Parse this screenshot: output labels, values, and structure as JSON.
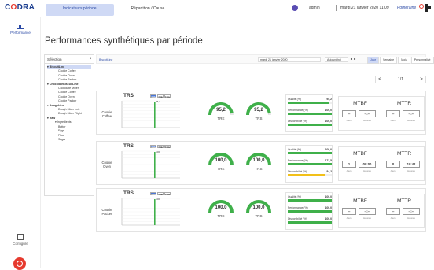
{
  "app": {
    "logo_prefix": "C",
    "logo_o": "O",
    "logo_suffix": "DRA"
  },
  "tabs": [
    "Indicateurs période",
    "Répartition / Cause"
  ],
  "header": {
    "user": "admin",
    "datetime": "mardi 21 janvier 2020 11:09",
    "brand": "Pomoraine"
  },
  "leftnav": {
    "performance": "Performance",
    "configure": "Configure"
  },
  "page": {
    "title": "Performances synthétiques par période"
  },
  "selector": {
    "label": "Sélection",
    "tree": [
      {
        "label": "BiscuitLine",
        "level": "group",
        "hl": true
      },
      {
        "label": "Cookie Coffee",
        "level": "l3"
      },
      {
        "label": "Cookie Oven",
        "level": "l3"
      },
      {
        "label": "Cookie Packer",
        "level": "l3"
      },
      {
        "label": "ChocolateBiscuitLine",
        "level": "group"
      },
      {
        "label": "Chocolate Mixer",
        "level": "l3"
      },
      {
        "label": "Cookie Coffee",
        "level": "l3"
      },
      {
        "label": "Cookie Oven",
        "level": "l3"
      },
      {
        "label": "Cookie Packer",
        "level": "l3"
      },
      {
        "label": "DoughLine",
        "level": "group"
      },
      {
        "label": "Dough Mixer Left",
        "level": "l3"
      },
      {
        "label": "Dough Mixer Right",
        "level": "l3"
      },
      {
        "label": "Raw",
        "level": "group"
      },
      {
        "label": "Ingredients",
        "level": "l2"
      },
      {
        "label": "Butter",
        "level": "l3"
      },
      {
        "label": "Eggs",
        "level": "l3"
      },
      {
        "label": "Flour",
        "level": "l3"
      },
      {
        "label": "Sugar",
        "level": "l3"
      }
    ]
  },
  "filter": {
    "crumb": "BiscuitLine",
    "date": "mardi 21 janvier 2020",
    "period": "Aujourd'hui",
    "arrows": "◄ ►",
    "buttons": [
      "Jour",
      "Semaine",
      "Mois",
      "Personnalisé"
    ],
    "active_button": "Jour"
  },
  "pager": {
    "prev": "<",
    "text": "1/1",
    "next": ">"
  },
  "labels": {
    "chart_title": "TRS",
    "toggles": [
      "TRS",
      "TRE",
      "TRG"
    ],
    "gauge_tre": "TRE",
    "gauge_trs": "TRS",
    "qualite": "Qualité (%)",
    "performance": "Performance (%)",
    "disponibilite": "Disponibilité (%)",
    "mtbf": "MTBF",
    "mttr": "MTTR",
    "jours": "Jours",
    "heures": "Heures"
  },
  "cards": [
    {
      "name": "Cookie Coffee",
      "annot": "95,2",
      "gauge_tre": "95,2",
      "gauge_trs": "95,2",
      "tre_frac": 0.952,
      "trs_frac": 0.952,
      "qualite": "95,2",
      "performance": "100,0",
      "disponibilite": "100,0",
      "q_frac": 0.952,
      "p_frac": 1.0,
      "d_frac": 1.0,
      "mtbf_j": "--",
      "mtbf_h": "--:--",
      "mttr_j": "--",
      "mttr_h": "--:--"
    },
    {
      "name": "Cookie Oven",
      "annot": "100",
      "gauge_tre": "100,0",
      "gauge_trs": "100,0",
      "tre_frac": 1.0,
      "trs_frac": 1.0,
      "qualite": "100,0",
      "performance": "172,5",
      "disponibilite": "84,2",
      "q_frac": 1.0,
      "p_frac": 1.0,
      "d_frac": 0.842,
      "mtbf_j": "1",
      "mtbf_h": "00:00",
      "mttr_j": "0",
      "mttr_h": "10:42"
    },
    {
      "name": "Cookie Packer",
      "annot": "100",
      "gauge_tre": "100,0",
      "gauge_trs": "100,0",
      "tre_frac": 1.0,
      "trs_frac": 1.0,
      "qualite": "100,0",
      "performance": "100,0",
      "disponibilite": "100,0",
      "q_frac": 1.0,
      "p_frac": 1.0,
      "d_frac": 1.0,
      "mtbf_j": "--",
      "mtbf_h": "--:--",
      "mttr_j": "--",
      "mttr_h": "--:--"
    }
  ],
  "colors": {
    "accent": "#2b4aa6",
    "gauge": "#3fb04a",
    "bar_green": "#3fb04a",
    "bar_yellow": "#f2c019",
    "logo_red": "#e63a2e"
  }
}
